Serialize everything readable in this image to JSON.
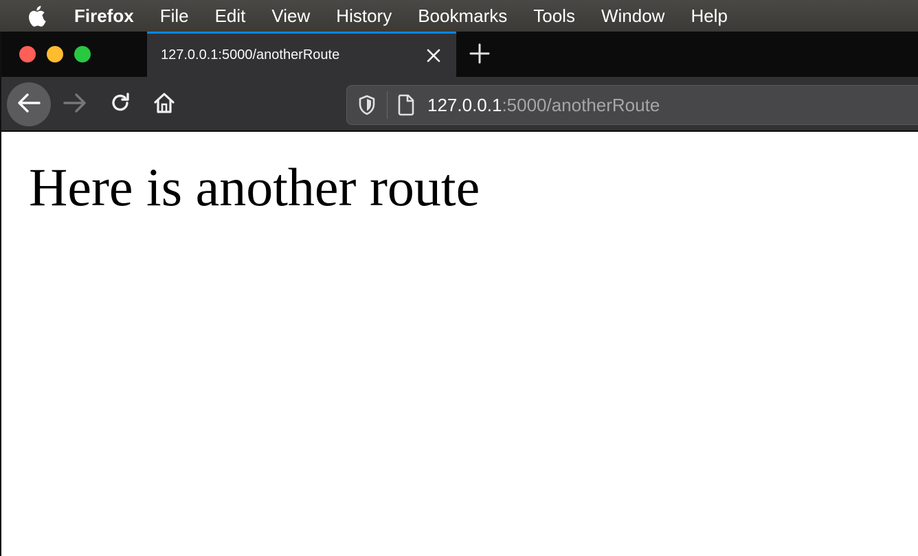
{
  "menubar": {
    "apple_icon": "apple-logo-icon",
    "items": [
      "Firefox",
      "File",
      "Edit",
      "View",
      "History",
      "Bookmarks",
      "Tools",
      "Window",
      "Help"
    ]
  },
  "tab": {
    "title": "127.0.0.1:5000/anotherRoute",
    "close_icon": "close-icon",
    "accent_color": "#0a84ff"
  },
  "toolbar": {
    "back_icon": "arrow-left-icon",
    "forward_icon": "arrow-right-icon",
    "reload_icon": "reload-icon",
    "home_icon": "home-icon"
  },
  "urlbar": {
    "host": "127.0.0.1",
    "path": ":5000/anotherRoute",
    "shield_icon": "shield-icon",
    "page_icon": "page-icon"
  },
  "page": {
    "heading": "Here is another route"
  },
  "colors": {
    "traffic_close": "#fe5f57",
    "traffic_minimize": "#febc2e",
    "traffic_maximize": "#28c840"
  }
}
